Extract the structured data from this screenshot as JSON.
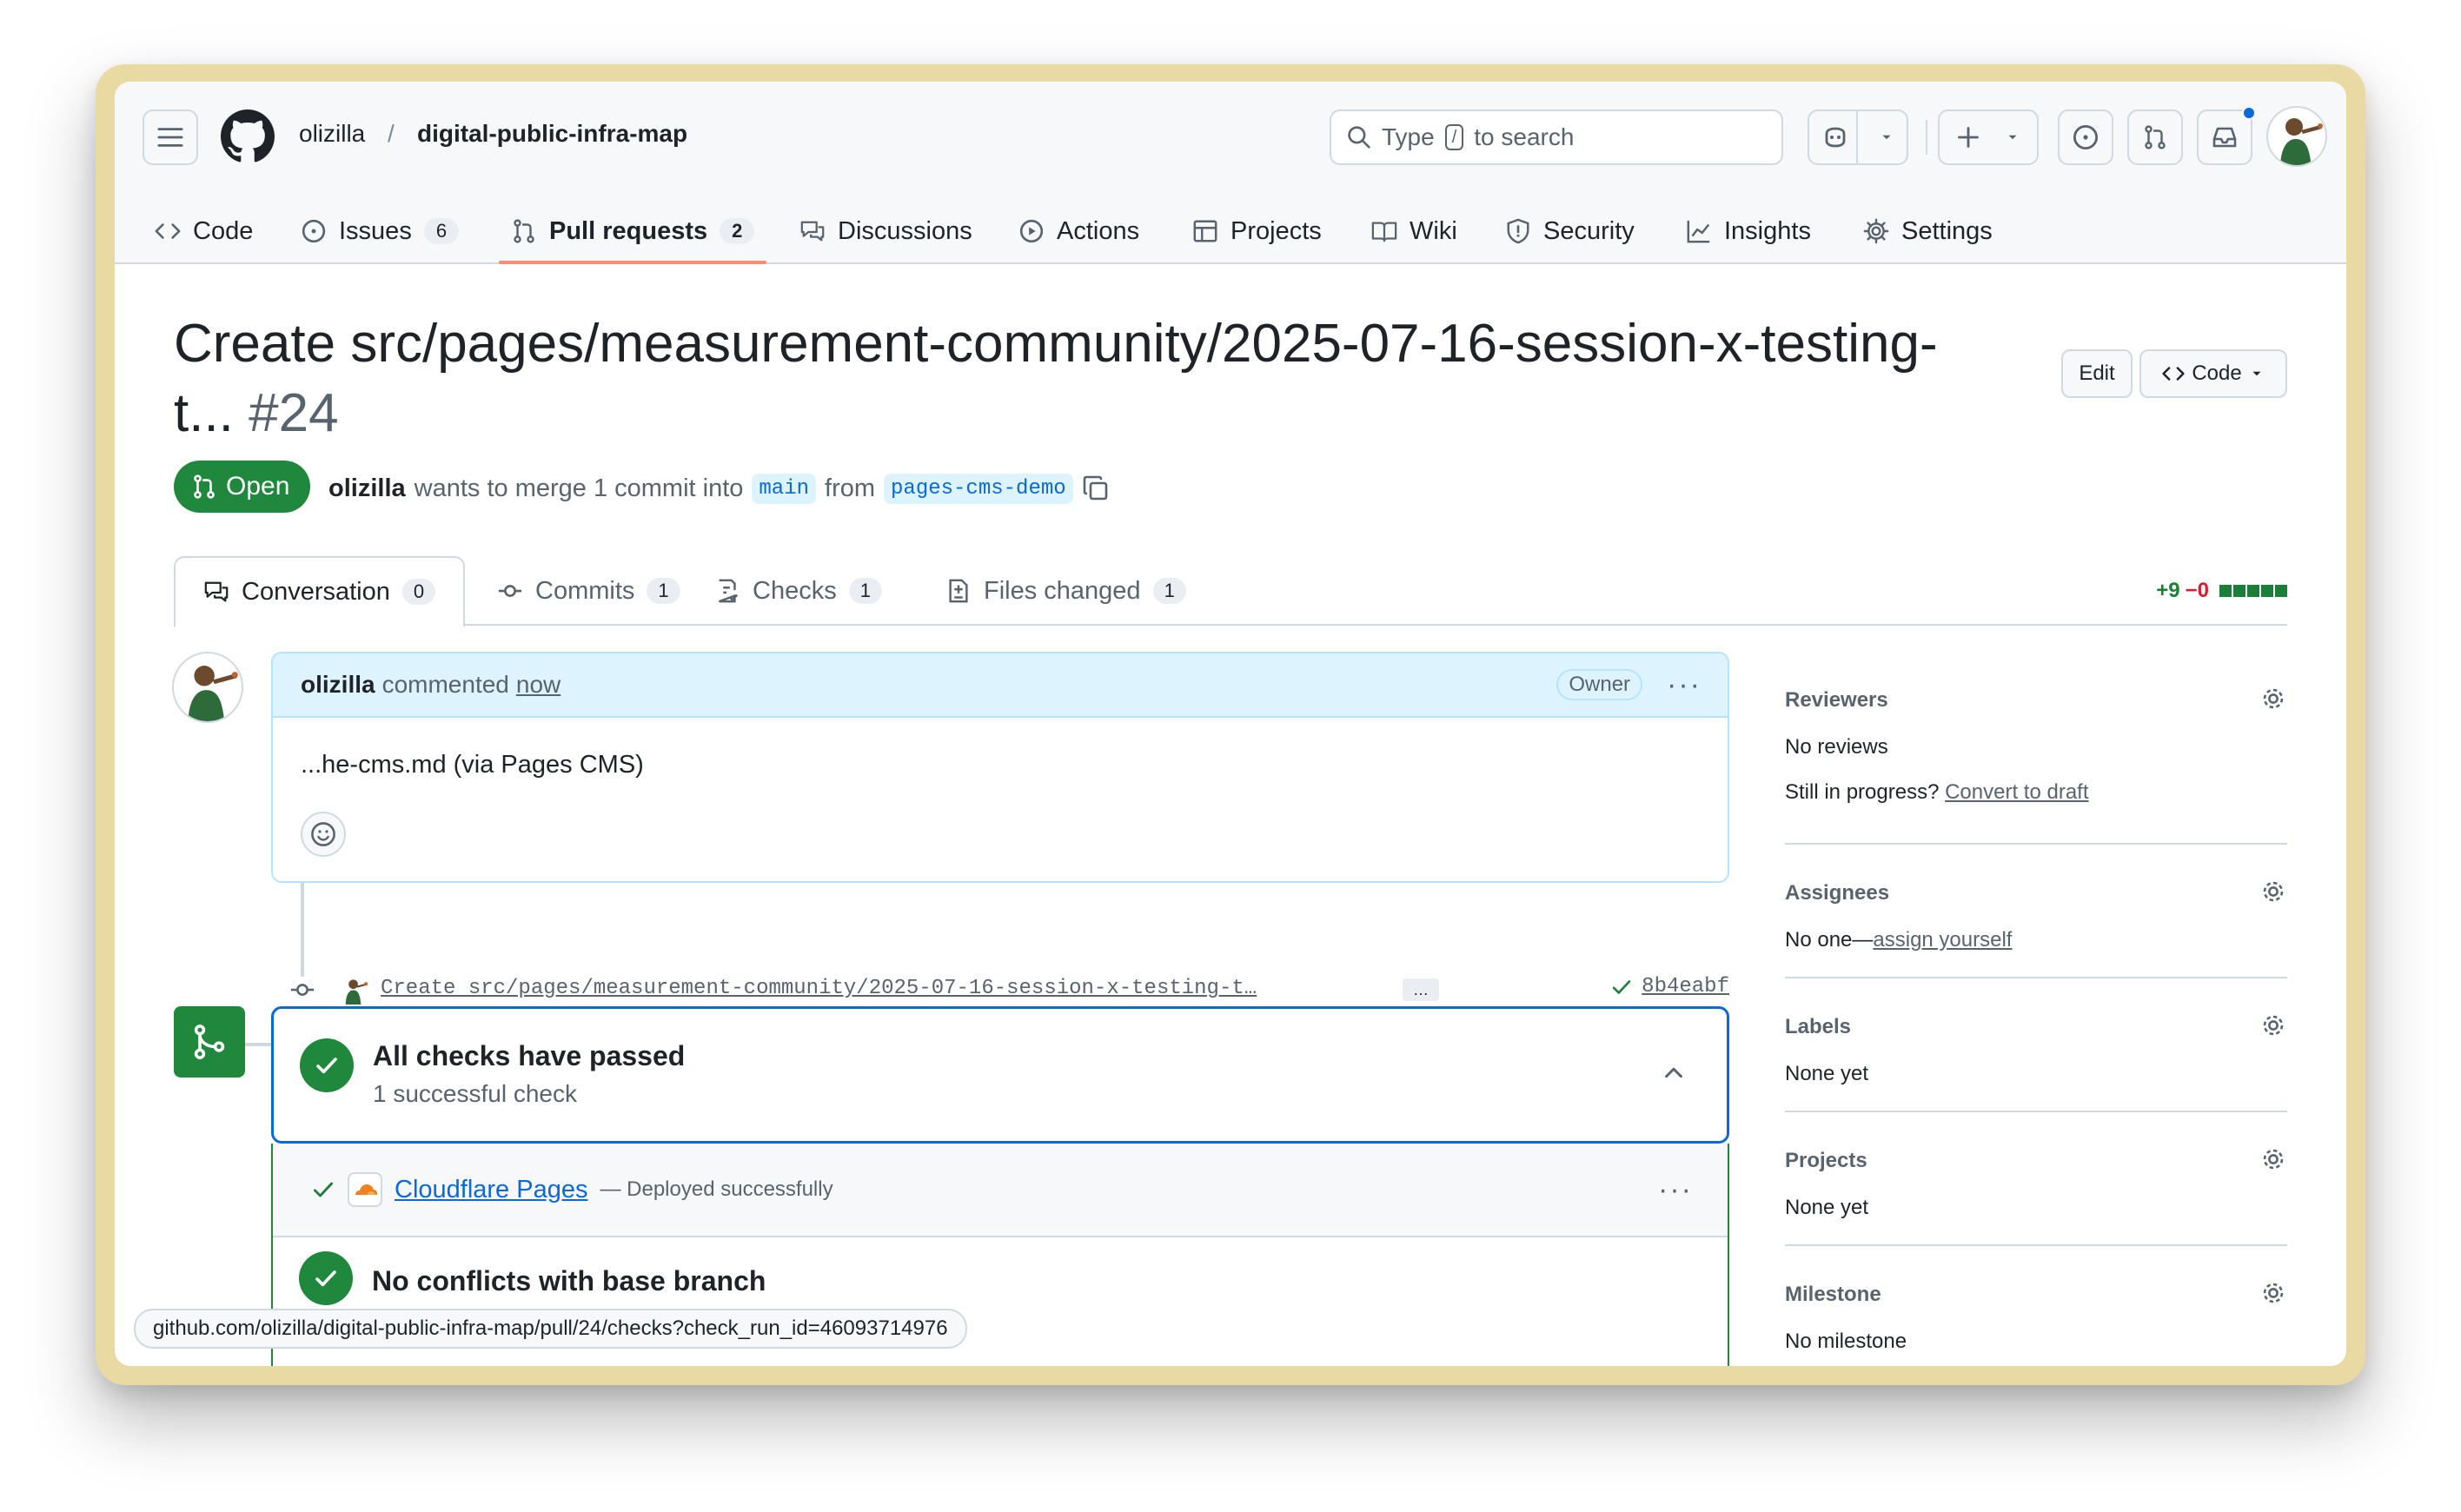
{
  "repo": {
    "owner": "olizilla",
    "separator": "/",
    "name": "digital-public-infra-map"
  },
  "search": {
    "prefix": "Type",
    "key": "/",
    "suffix": "to search"
  },
  "nav_tabs": [
    {
      "label": "Code"
    },
    {
      "label": "Issues",
      "count": "6"
    },
    {
      "label": "Pull requests",
      "count": "2"
    },
    {
      "label": "Discussions"
    },
    {
      "label": "Actions"
    },
    {
      "label": "Projects"
    },
    {
      "label": "Wiki"
    },
    {
      "label": "Security"
    },
    {
      "label": "Insights"
    },
    {
      "label": "Settings"
    }
  ],
  "pr": {
    "title_line1": "Create src/pages/measurement-community/2025-07-16-session-x-testing-",
    "title_line2": "t...",
    "number": "#24",
    "edit_label": "Edit",
    "code_label": "Code",
    "state": "Open",
    "author": "olizilla",
    "merge_text": "wants to merge 1 commit into",
    "base_branch": "main",
    "from_text": "from",
    "head_branch": "pages-cms-demo"
  },
  "pr_tabs": [
    {
      "label": "Conversation",
      "count": "0"
    },
    {
      "label": "Commits",
      "count": "1"
    },
    {
      "label": "Checks",
      "count": "1"
    },
    {
      "label": "Files changed",
      "count": "1"
    }
  ],
  "diffstat": {
    "additions": "+9",
    "deletions": "−0"
  },
  "comment": {
    "author": "olizilla",
    "action": "commented",
    "time": "now",
    "badge": "Owner",
    "body": "...he-cms.md (via Pages CMS)"
  },
  "commit": {
    "message": "Create src/pages/measurement-community/2025-07-16-session-x-testing-t…",
    "ellipsis": "…",
    "sha": "8b4eabf"
  },
  "checks": {
    "title": "All checks have passed",
    "subtitle": "1 successful check",
    "run_name": "Cloudflare Pages",
    "run_status": "— Deployed successfully",
    "conflicts_title": "No conflicts with base branch"
  },
  "status_url": "github.com/olizilla/digital-public-infra-map/pull/24/checks?check_run_id=46093714976",
  "sidebar": {
    "reviewers": {
      "title": "Reviewers",
      "value": "No reviews",
      "progress_text": "Still in progress?",
      "progress_link": "Convert to draft"
    },
    "assignees": {
      "title": "Assignees",
      "value": "No one—",
      "link": "assign yourself"
    },
    "labels": {
      "title": "Labels",
      "value": "None yet"
    },
    "projects": {
      "title": "Projects",
      "value": "None yet"
    },
    "milestone": {
      "title": "Milestone",
      "value": "No milestone"
    }
  },
  "colors": {
    "accent": "#0969da",
    "open": "#1f883d",
    "tab_underline": "#fd8c73",
    "frame": "#e9d9a3"
  }
}
